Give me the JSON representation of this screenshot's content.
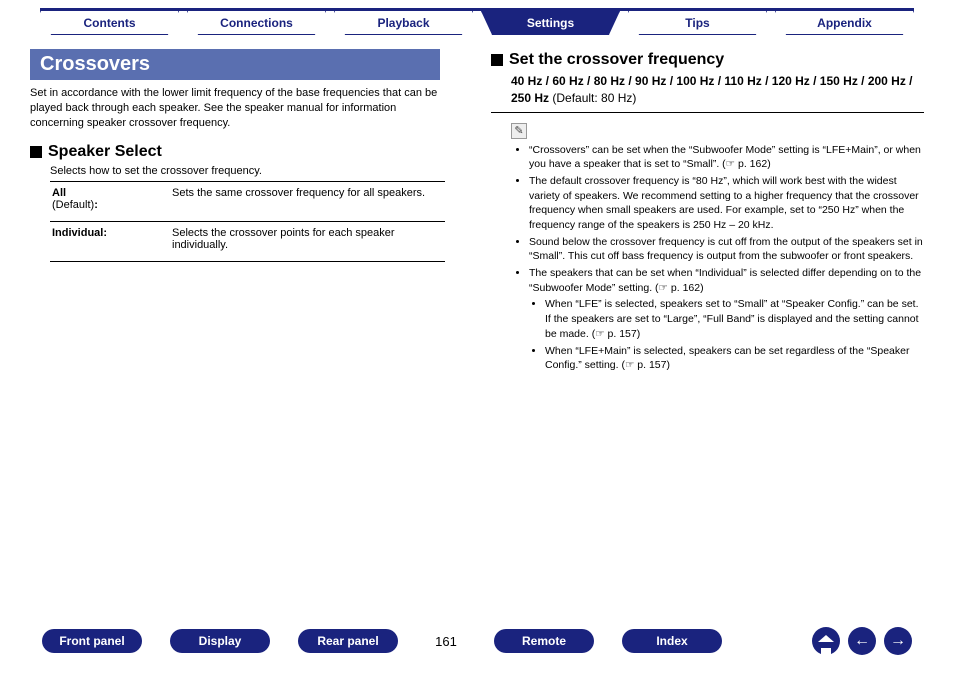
{
  "topnav": {
    "tabs": [
      {
        "label": "Contents",
        "active": false
      },
      {
        "label": "Connections",
        "active": false
      },
      {
        "label": "Playback",
        "active": false
      },
      {
        "label": "Settings",
        "active": true
      },
      {
        "label": "Tips",
        "active": false
      },
      {
        "label": "Appendix",
        "active": false
      }
    ]
  },
  "left": {
    "title": "Crossovers",
    "intro": "Set in accordance with the lower limit frequency of the base frequencies that can be played back through each speaker. See the speaker manual for information concerning speaker crossover frequency.",
    "section1": {
      "heading": "Speaker Select",
      "sub": "Selects how to set the crossover frequency.",
      "rows": [
        {
          "key_strong": "All",
          "key_rest": "(Default)",
          "key_suffix": ":",
          "val": "Sets the same crossover frequency for all speakers."
        },
        {
          "key_strong": "Individual:",
          "key_rest": "",
          "key_suffix": "",
          "val": "Selects the crossover points for each speaker individually."
        }
      ]
    }
  },
  "right": {
    "heading": "Set the crossover frequency",
    "freq_strong": "40 Hz / 60 Hz / 80 Hz / 90 Hz / 100 Hz / 110 Hz / 120 Hz / 150 Hz / 200 Hz / 250 Hz",
    "freq_default": " (Default: 80 Hz)",
    "notes": [
      "“Crossovers” can be set when the “Subwoofer Mode” setting is “LFE+Main”, or when you have a speaker that is set to “Small”.  (☞ p. 162)",
      "The default crossover frequency is “80 Hz”, which will work best with the widest variety of speakers. We recommend setting to a higher frequency that the crossover frequency when small speakers are used. For example, set to “250 Hz” when the frequency range of the speakers is 250 Hz – 20 kHz.",
      "Sound below the crossover frequency is cut off from the output of the speakers set in “Small”. This cut off bass frequency is output from the subwoofer or front speakers.",
      "The speakers that can be set when “Individual” is selected differ depending on to the “Subwoofer Mode” setting.  (☞ p. 162)"
    ],
    "subnotes": [
      "When “LFE” is selected, speakers set to “Small” at “Speaker Config.” can be set. If the speakers are set to “Large”, “Full Band” is displayed and the setting cannot be made.  (☞ p. 157)",
      "When “LFE+Main” is selected, speakers can be set regardless of the “Speaker Config.” setting.  (☞ p. 157)"
    ]
  },
  "footer": {
    "pills": [
      "Front panel",
      "Display",
      "Rear panel"
    ],
    "page": "161",
    "pills2": [
      "Remote",
      "Index"
    ]
  }
}
